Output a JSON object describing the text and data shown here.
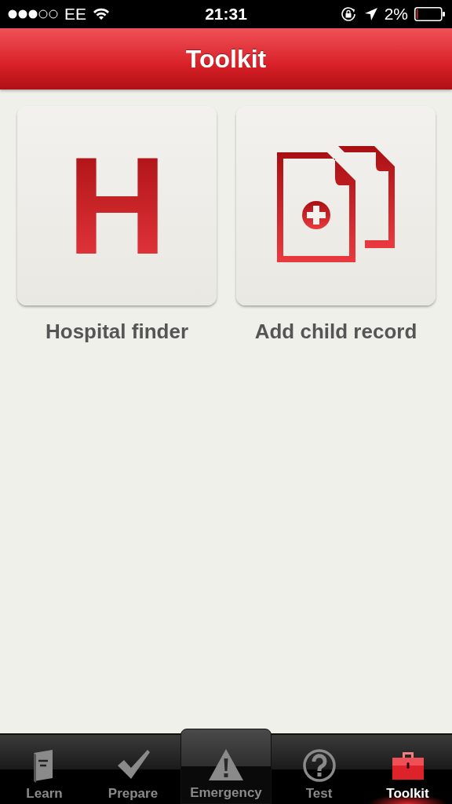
{
  "status_bar": {
    "carrier": "EE",
    "time": "21:31",
    "battery": "2%"
  },
  "header": {
    "title": "Toolkit"
  },
  "tiles": [
    {
      "kind": "letter",
      "glyph": "H",
      "label": "Hospital finder"
    },
    {
      "kind": "documents",
      "label": "Add child record"
    }
  ],
  "tabs": [
    {
      "kind": "book",
      "label": "Learn",
      "selected": false,
      "featured": false
    },
    {
      "kind": "check",
      "label": "Prepare",
      "selected": false,
      "featured": false
    },
    {
      "kind": "warning",
      "label": "Emergency",
      "selected": false,
      "featured": true
    },
    {
      "kind": "question",
      "label": "Test",
      "selected": false,
      "featured": false
    },
    {
      "kind": "toolbox",
      "label": "Toolkit",
      "selected": true,
      "featured": false
    }
  ]
}
